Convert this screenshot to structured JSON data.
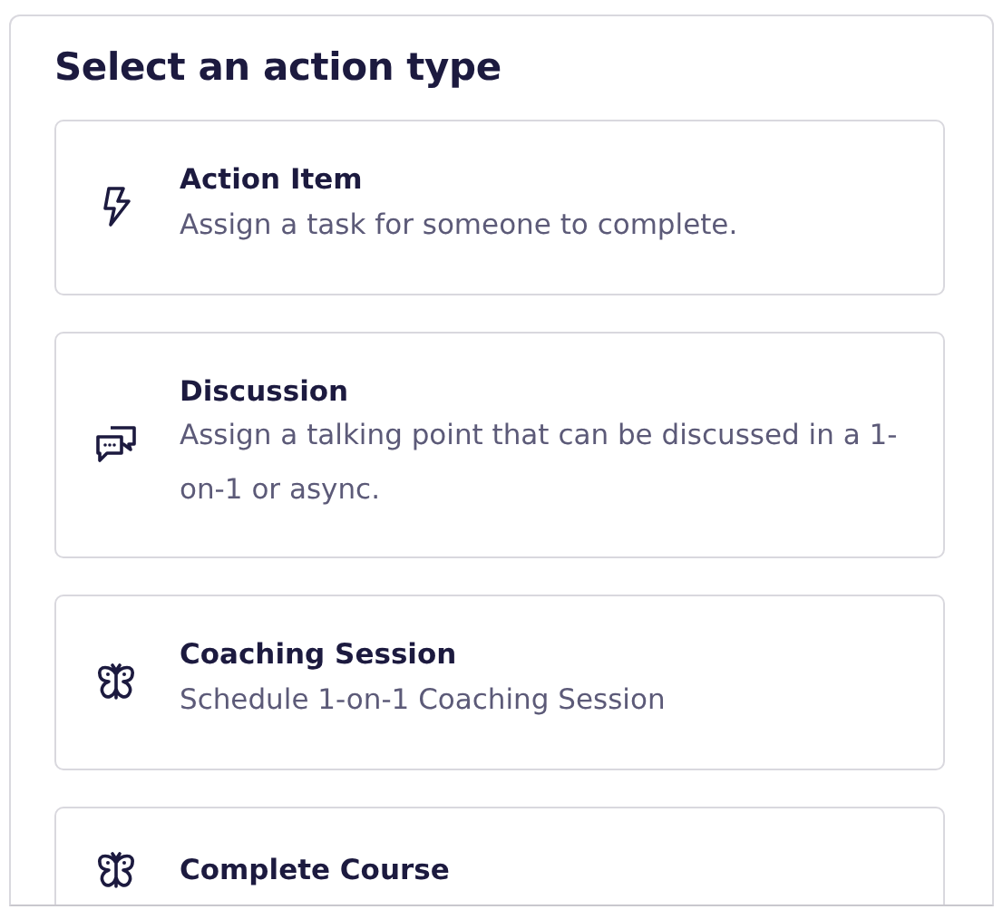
{
  "heading": "Select an action type",
  "options": [
    {
      "kind": "bolt",
      "title": "Action Item",
      "description": "Assign a task for someone to complete."
    },
    {
      "kind": "chat",
      "title": "Discussion",
      "description": "Assign a talking point that can be discussed in a 1-on-1 or async."
    },
    {
      "kind": "butterfly",
      "title": "Coaching Session",
      "description": "Schedule 1-on-1 Coaching Session"
    },
    {
      "kind": "butterfly",
      "title": "Complete Course"
    }
  ]
}
